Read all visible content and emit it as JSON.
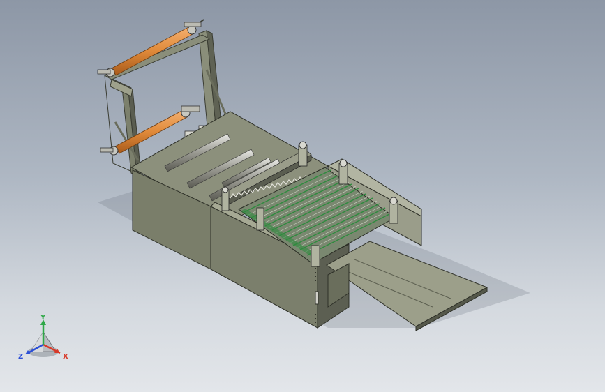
{
  "viewport": {
    "background_top": "#8d97a6",
    "background_bottom": "#e3e6ea"
  },
  "model": {
    "body_color": "#7b7f6c",
    "roller_color": "#e08a3a",
    "green_accent": "#2e8b3e"
  },
  "triad": {
    "x_label": "X",
    "y_label": "Y",
    "z_label": "Z",
    "x_color": "#d83a2a",
    "y_color": "#2fa848",
    "z_color": "#2b4fd6"
  }
}
